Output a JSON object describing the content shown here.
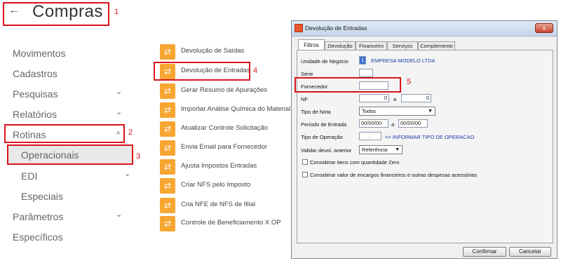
{
  "header": {
    "back_icon": "arrow-left-icon",
    "title": "Compras"
  },
  "nav": {
    "items": [
      {
        "label": "Movimentos"
      },
      {
        "label": "Cadastros"
      },
      {
        "label": "Pesquisas"
      },
      {
        "label": "Relatórios"
      },
      {
        "label": "Rotinas"
      },
      {
        "label": "Parâmetros"
      },
      {
        "label": "Específicos"
      }
    ],
    "sub": [
      {
        "label": "Operacionais"
      },
      {
        "label": "EDI"
      },
      {
        "label": "Especiais"
      }
    ],
    "chevron_down": "⌄",
    "chevron_up": "^"
  },
  "menu_items": [
    {
      "label": "Devolução  de Saídas"
    },
    {
      "label": "Devolução de Entradas"
    },
    {
      "label": "Gerar Resumo de Apurações"
    },
    {
      "label": "Importar Análise Química do Material"
    },
    {
      "label": "Atualizar Controle Solicitação"
    },
    {
      "label": "Envia Email para Fornecedor"
    },
    {
      "label": "Ajusta Impostos Entradas"
    },
    {
      "label": "Criar NFS pelo Imposto"
    },
    {
      "label": "Cria NFE de NFS de filial"
    },
    {
      "label": "Controle de Beneficiamento X OP"
    }
  ],
  "menu_icon_glyph": "⇄",
  "dialog": {
    "title": "Devolução de Entradas",
    "close": "x",
    "tabs": [
      "Filtros",
      "Devolução",
      "Financeiro",
      "Serviços",
      "Complemento"
    ],
    "unidade_label": "Unidade de Negócio",
    "unidade_code": "1",
    "unidade_name": "EMPRESA MODELO LTDA",
    "serie_label": "Série",
    "fornecedor_label": "Fornecedor",
    "nf_label": "NF",
    "nf_from": "0",
    "nf_a": "a",
    "nf_to": "0",
    "tipo_nota_label": "Tipo de Nota",
    "tipo_nota_value": "Todos",
    "periodo_label": "Período de Entrada",
    "periodo_from": "00/00/00",
    "periodo_a": "a",
    "periodo_to": "00/00/00",
    "tipo_operacao_label": "Tipo de Operação",
    "tipo_operacao_value": ".",
    "tipo_operacao_hint": "=> INFORMAR TIPO DE OPERACAO",
    "validar_label": "Validar devol. anterior",
    "validar_value": "Referência",
    "chk1_label": "Considerar itens com quantidade Zero",
    "chk2_label": "Considerar valor de encargos financeiros e outras despesas acessórias",
    "confirm_label": "Confirmar",
    "cancel_label": "Cancelar"
  },
  "annotations": [
    "1",
    "2",
    "3",
    "4",
    "5"
  ],
  "colors": {
    "annotation": "#d9141c",
    "menu_icon": "#f7a631"
  }
}
